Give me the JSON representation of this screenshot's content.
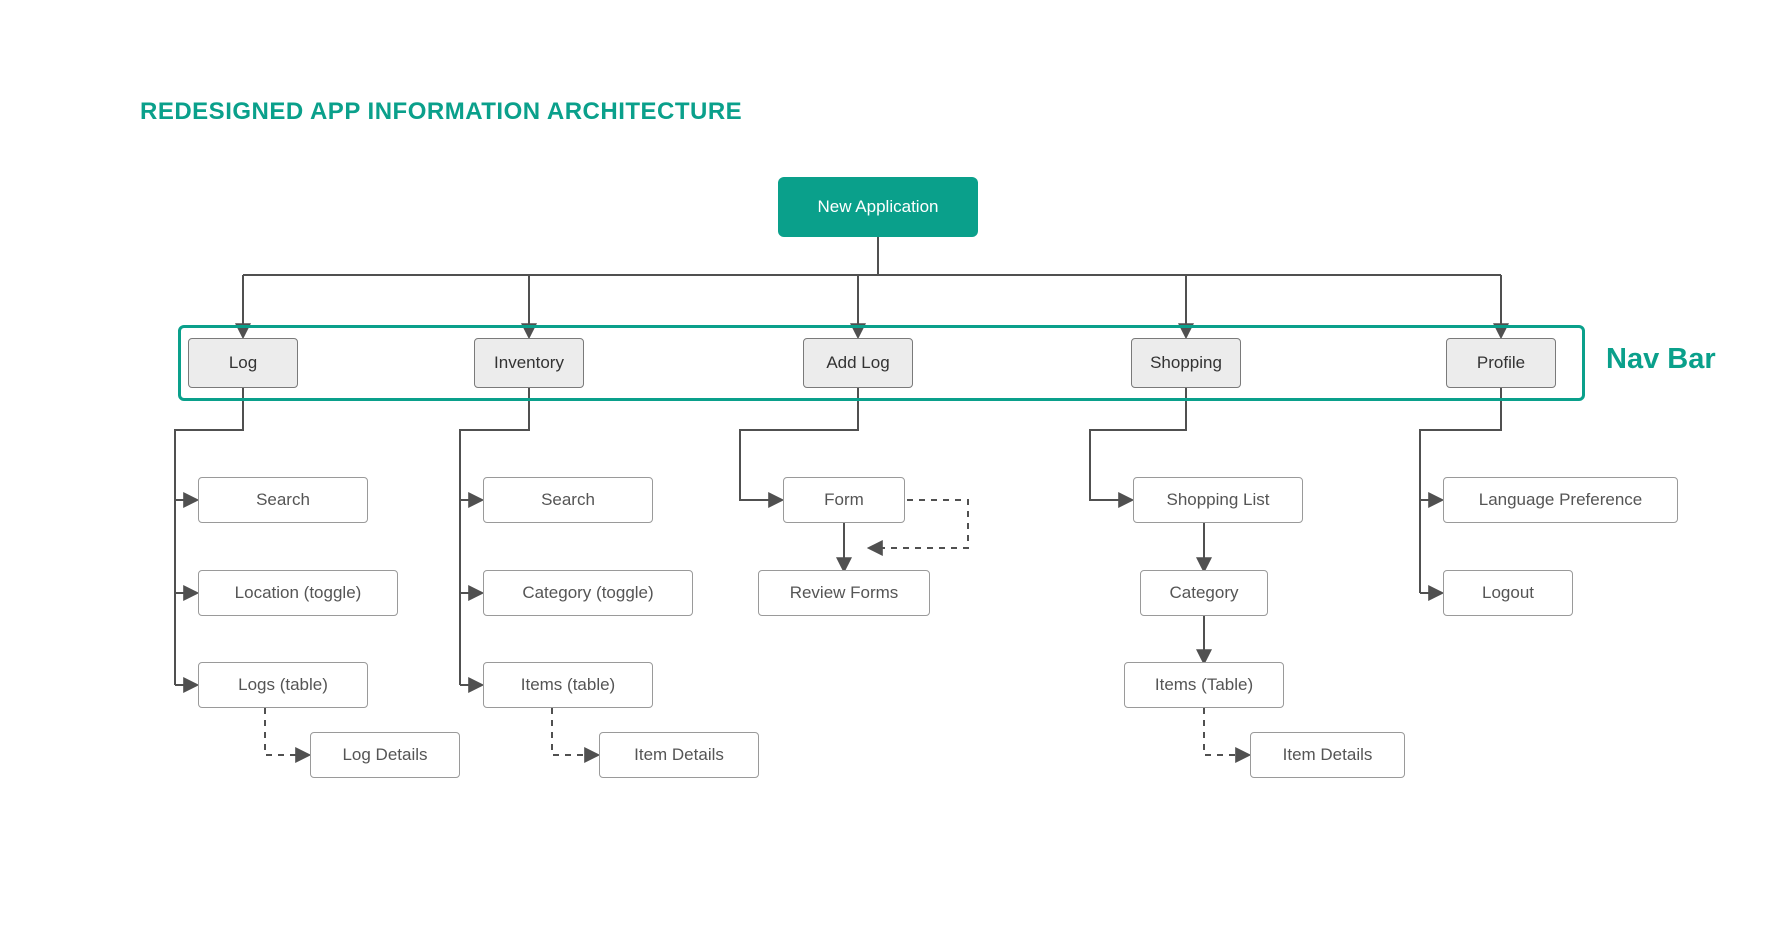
{
  "title": "REDESIGNED APP INFORMATION ARCHITECTURE",
  "root": "New Application",
  "nav_label": "Nav Bar",
  "nav": {
    "log": "Log",
    "inventory": "Inventory",
    "addlog": "Add Log",
    "shopping": "Shopping",
    "profile": "Profile"
  },
  "log": {
    "search": "Search",
    "location": "Location (toggle)",
    "logs": "Logs (table)",
    "details": "Log Details"
  },
  "inventory": {
    "search": "Search",
    "category": "Category (toggle)",
    "items": "Items (table)",
    "details": "Item Details"
  },
  "addlog": {
    "form": "Form",
    "review": "Review Forms"
  },
  "shopping": {
    "list": "Shopping List",
    "category": "Category",
    "items": "Items (Table)",
    "details": "Item Details"
  },
  "profile": {
    "language": "Language Preference",
    "logout": "Logout"
  }
}
